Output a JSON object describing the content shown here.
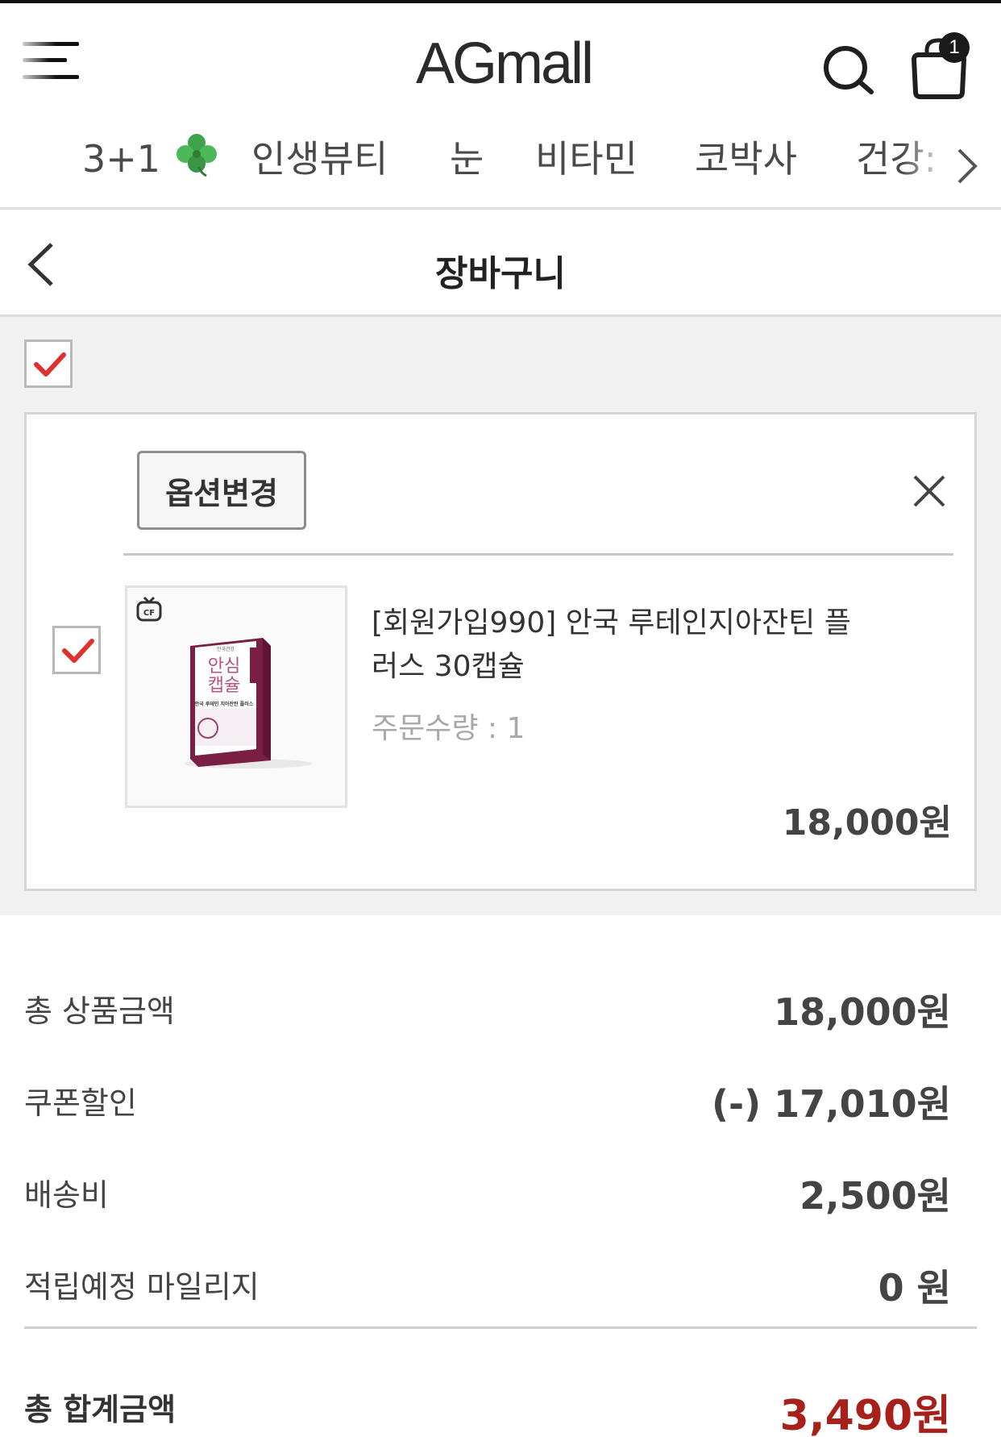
{
  "header": {
    "logo": "AGmall",
    "cart_count": "1"
  },
  "categories": [
    {
      "label": "3+1",
      "icon": "clover-icon"
    },
    {
      "label": "인생뷰티"
    },
    {
      "label": "눈"
    },
    {
      "label": "비타민"
    },
    {
      "label": "코박사"
    },
    {
      "label": "건강:"
    }
  ],
  "page": {
    "title": "장바구니"
  },
  "cart": {
    "select_all_checked": true,
    "items": [
      {
        "checked": true,
        "option_change_label": "옵션변경",
        "name": "[회원가입990] 안국 루테인지아잔틴 플러스 30캡슐",
        "quantity_label": "주문수량 : ",
        "quantity": "1",
        "price": "18,000원",
        "thumb_badge": "CF",
        "package_text": {
          "brand": "안국건강",
          "line1": "안심",
          "line2": "캡슐",
          "title": "안국 루테인 지아잔틴 플러스"
        }
      }
    ]
  },
  "summary": {
    "rows": [
      {
        "label": "총 상품금액",
        "value": "18,000원"
      },
      {
        "label": "쿠폰할인",
        "value": "(-) 17,010원"
      },
      {
        "label": "배송비",
        "value": "2,500원"
      },
      {
        "label": "적립예정 마일리지",
        "value": "0 원"
      }
    ],
    "total_label": "총 합계금액",
    "total_value": "3,490원"
  },
  "colors": {
    "accent_red": "#a8201a",
    "check_red": "#e03131",
    "background_gray": "#f1f1f1"
  }
}
